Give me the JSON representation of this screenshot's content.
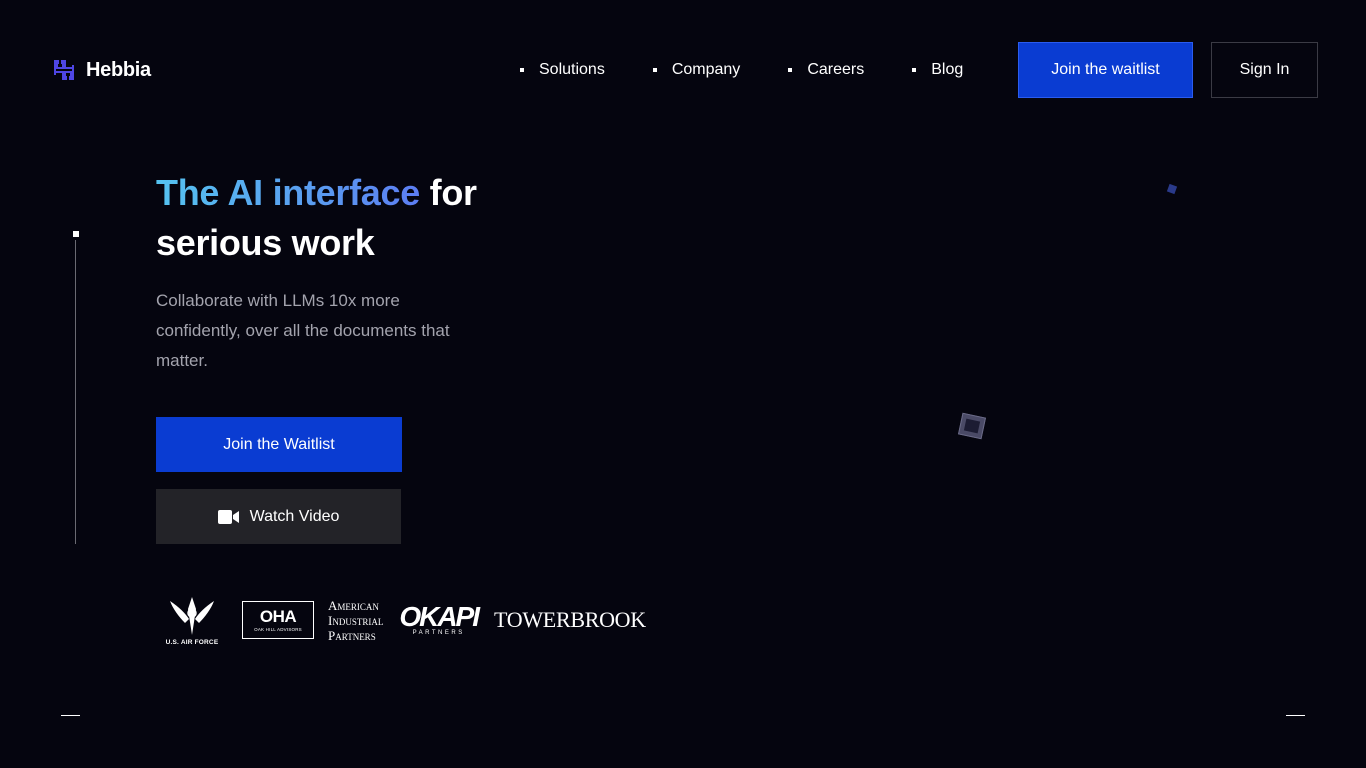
{
  "brand": {
    "name": "Hebbia",
    "logo_icon": "hebbia-logo-icon"
  },
  "nav": {
    "items": [
      {
        "label": "Solutions"
      },
      {
        "label": "Company"
      },
      {
        "label": "Careers"
      },
      {
        "label": "Blog"
      }
    ],
    "join_label": "Join the waitlist",
    "signin_label": "Sign In"
  },
  "hero": {
    "title_highlight": "The AI interface",
    "title_rest_1": "for",
    "title_rest_2": "serious work",
    "subtitle": "Collaborate with LLMs 10x more confidently, over all the documents that matter.",
    "primary_cta": "Join the Waitlist",
    "secondary_cta": "Watch Video",
    "secondary_icon": "video-camera-icon"
  },
  "customers": {
    "air_force": "U.S. AIR FORCE",
    "oha_main": "OHA",
    "oha_sub": "OAK HILL ADVISORS",
    "aip_lines": [
      "American",
      "Industrial",
      "Partners"
    ],
    "okapi_main": "OKAPI",
    "okapi_sub": "PARTNERS",
    "towerbrook": "TOWERBROOK"
  },
  "colors": {
    "background": "#05050f",
    "primary": "#0a3cd2",
    "gradient_start": "#55c3f0",
    "gradient_end": "#5c7df2",
    "secondary_button": "#232328",
    "subtitle_text": "#a3a3ad"
  }
}
